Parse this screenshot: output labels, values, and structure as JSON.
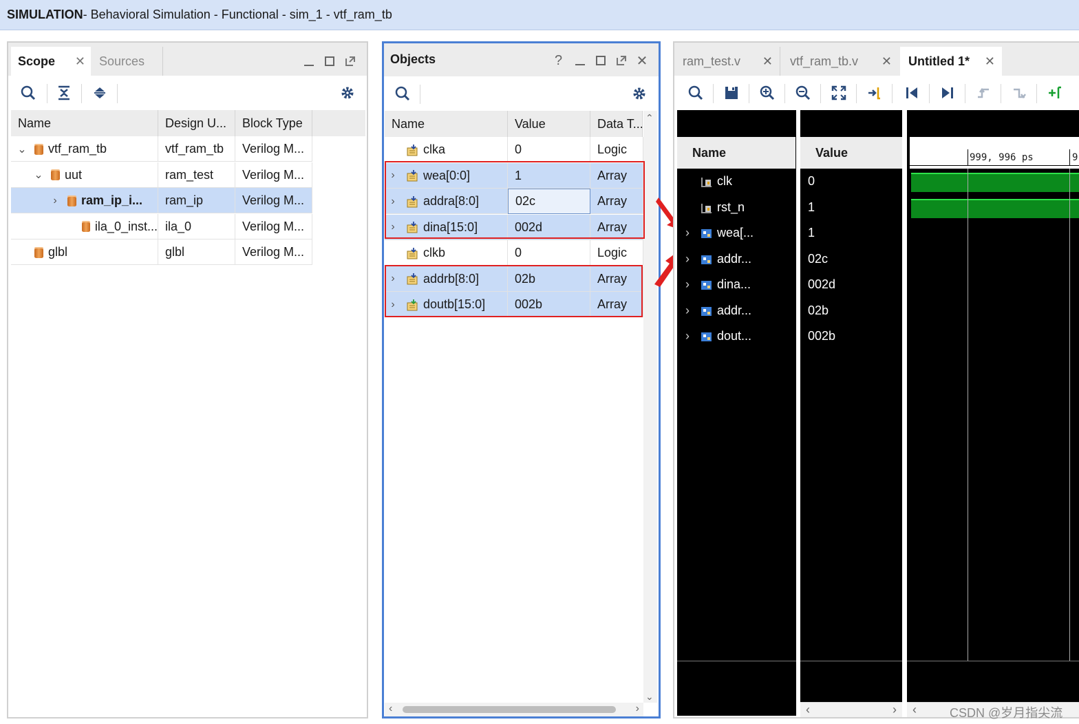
{
  "window": {
    "title_bold": "SIMULATION",
    "title_rest": " - Behavioral Simulation - Functional - sim_1 - vtf_ram_tb"
  },
  "scope_panel": {
    "tabs": [
      {
        "label": "Scope",
        "active": true
      },
      {
        "label": "Sources",
        "active": false
      }
    ],
    "columns": [
      "Name",
      "Design U...",
      "Block Type"
    ],
    "rows": [
      {
        "name": "vtf_ram_tb",
        "design_unit": "vtf_ram_tb",
        "block_type": "Verilog M...",
        "expander": "⌄",
        "indent": 0
      },
      {
        "name": "uut",
        "design_unit": "ram_test",
        "block_type": "Verilog M...",
        "expander": "⌄",
        "indent": 1
      },
      {
        "name": "ram_ip_i...",
        "design_unit": "ram_ip",
        "block_type": "Verilog M...",
        "expander": "›",
        "indent": 2,
        "selected": true
      },
      {
        "name": "ila_0_inst...",
        "design_unit": "ila_0",
        "block_type": "Verilog M...",
        "expander": "",
        "indent": 3
      },
      {
        "name": "glbl",
        "design_unit": "glbl",
        "block_type": "Verilog M...",
        "expander": "",
        "indent": 0
      }
    ]
  },
  "objects_panel": {
    "title": "Objects",
    "help": "?",
    "columns": [
      "Name",
      "Value",
      "Data T..."
    ],
    "rows": [
      {
        "name": "clka",
        "value": "0",
        "type": "Logic",
        "expander": "",
        "highlight": false
      },
      {
        "name": "wea[0:0]",
        "value": "1",
        "type": "Array",
        "expander": "›",
        "highlight": true
      },
      {
        "name": "addra[8:0]",
        "value": "02c",
        "type": "Array",
        "expander": "›",
        "highlight": true
      },
      {
        "name": "dina[15:0]",
        "value": "002d",
        "type": "Array",
        "expander": "›",
        "highlight": true
      },
      {
        "name": "clkb",
        "value": "0",
        "type": "Logic",
        "expander": "",
        "highlight": false
      },
      {
        "name": "addrb[8:0]",
        "value": "02b",
        "type": "Array",
        "expander": "›",
        "highlight": true
      },
      {
        "name": "doutb[15:0]",
        "value": "002b",
        "type": "Array",
        "expander": "›",
        "highlight": true
      }
    ]
  },
  "wave_panel": {
    "tabs": [
      {
        "label": "ram_test.v",
        "active": false
      },
      {
        "label": "vtf_ram_tb.v",
        "active": false
      },
      {
        "label": "Untitled 1*",
        "active": true
      }
    ],
    "columns": [
      "Name",
      "Value"
    ],
    "cursor_label": "999, 996 ps",
    "cursor_label_next": "9",
    "signals": [
      {
        "name": "clk",
        "value": "0",
        "expander": ""
      },
      {
        "name": "rst_n",
        "value": "1",
        "expander": ""
      },
      {
        "name": "wea[...",
        "value": "1",
        "expander": "›"
      },
      {
        "name": "addr...",
        "value": "02c",
        "expander": "›"
      },
      {
        "name": "dina...",
        "value": "002d",
        "expander": "›"
      },
      {
        "name": "addr...",
        "value": "02b",
        "expander": "›"
      },
      {
        "name": "dout...",
        "value": "002b",
        "expander": "›"
      }
    ]
  },
  "watermark": "CSDN @岁月指尖流",
  "colors": {
    "titlebar": "#d6e3f7",
    "selection": "#c8dbf7",
    "objects_border": "#4a7fd4",
    "highlight_box": "#e02020",
    "arrow": "#e02020",
    "wave_green": "#0b8a1c"
  }
}
